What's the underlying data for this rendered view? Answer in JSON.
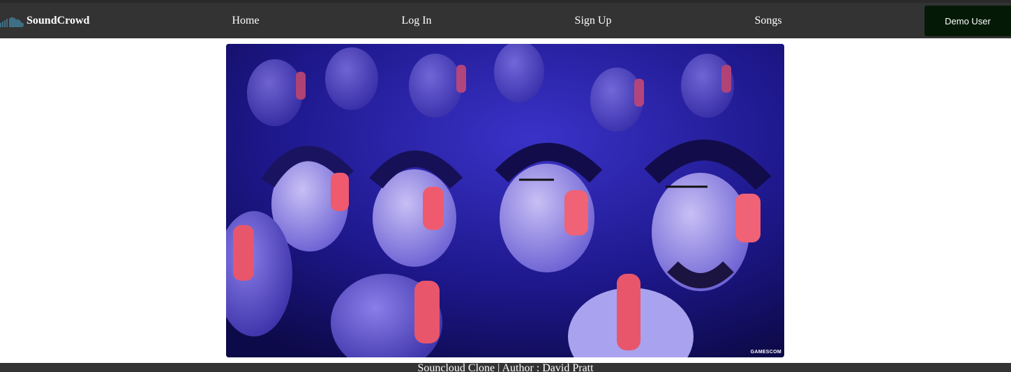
{
  "navbar": {
    "brand": "SoundCrowd",
    "brand_icon": "soundcloud-logo-icon",
    "links": {
      "home": "Home",
      "login": "Log In",
      "signup": "Sign Up",
      "songs": "Songs"
    },
    "demo_button": "Demo User"
  },
  "hero": {
    "image_watermark": "GAMESCOM"
  },
  "footer": {
    "text": "Souncloud Clone | Author : David Pratt"
  },
  "colors": {
    "navbar_bg": "#333333",
    "demo_button_bg": "#051a06",
    "text": "#ffffff",
    "page_bg": "#ffffff"
  }
}
